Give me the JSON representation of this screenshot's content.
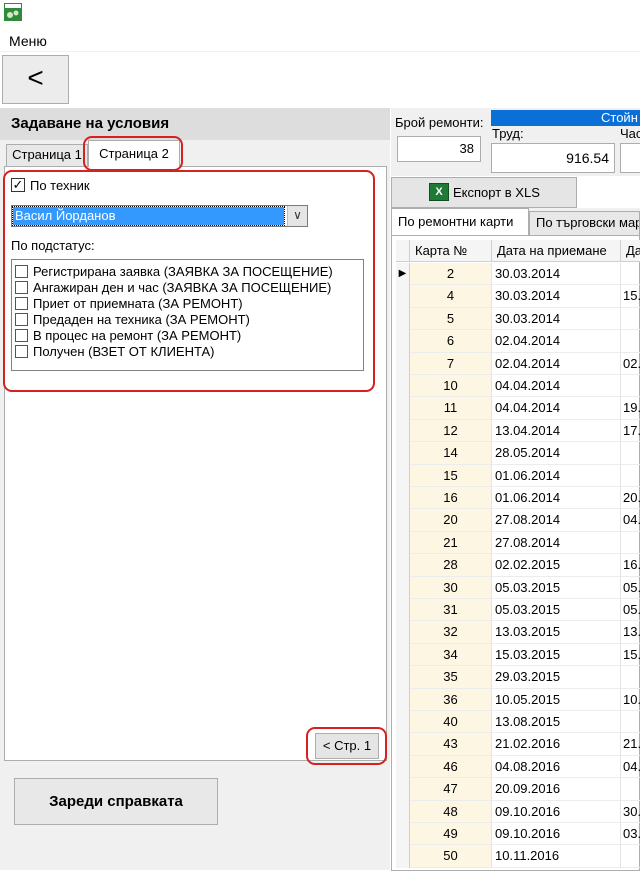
{
  "menu": {
    "label": "Меню"
  },
  "back_button": {
    "label": "<"
  },
  "left_panel": {
    "title": "Задаване на условия",
    "tabs": [
      "Страница 1",
      "Страница 2"
    ],
    "by_technician": {
      "label": "По техник",
      "checked": true
    },
    "technician_select": {
      "value": "Васил Йорданов"
    },
    "substatus_label": "По подстатус:",
    "substatus_items": [
      "Регистрирана заявка (ЗАЯВКА ЗА ПОСЕЩЕНИЕ)",
      "Ангажиран ден и час (ЗАЯВКА ЗА ПОСЕЩЕНИЕ)",
      "Приет от приемната (ЗА РЕМОНТ)",
      "Предаден на техника (ЗА РЕМОНТ)",
      "В процес на ремонт (ЗА РЕМОНТ)",
      "Получен (ВЗЕТ ОТ КЛИЕНТА)"
    ],
    "page1_button": "< Стр. 1",
    "load_button": "Зареди справката"
  },
  "summary": {
    "count_label": "Брой ремонти:",
    "count_value": "38",
    "value_header": "Стойн",
    "labor_label": "Труд:",
    "labor_value": "916.54",
    "hours_label": "Час"
  },
  "export_button": "Експорт в XLS",
  "export_icon": "excel-icon",
  "right_tabs": [
    "По ремонтни карти",
    "По търговски мар"
  ],
  "grid": {
    "headers": [
      "Карта №",
      "Дата на приемане",
      "Дат"
    ],
    "rows": [
      [
        "2",
        "30.03.2014",
        ""
      ],
      [
        "4",
        "30.03.2014",
        "15."
      ],
      [
        "5",
        "30.03.2014",
        ""
      ],
      [
        "6",
        "02.04.2014",
        ""
      ],
      [
        "7",
        "02.04.2014",
        "02."
      ],
      [
        "10",
        "04.04.2014",
        ""
      ],
      [
        "11",
        "04.04.2014",
        "19."
      ],
      [
        "12",
        "13.04.2014",
        "17."
      ],
      [
        "14",
        "28.05.2014",
        ""
      ],
      [
        "15",
        "01.06.2014",
        ""
      ],
      [
        "16",
        "01.06.2014",
        "20."
      ],
      [
        "20",
        "27.08.2014",
        "04."
      ],
      [
        "21",
        "27.08.2014",
        ""
      ],
      [
        "28",
        "02.02.2015",
        "16."
      ],
      [
        "30",
        "05.03.2015",
        "05."
      ],
      [
        "31",
        "05.03.2015",
        "05."
      ],
      [
        "32",
        "13.03.2015",
        "13."
      ],
      [
        "34",
        "15.03.2015",
        "15."
      ],
      [
        "35",
        "29.03.2015",
        ""
      ],
      [
        "36",
        "10.05.2015",
        "10."
      ],
      [
        "40",
        "13.08.2015",
        ""
      ],
      [
        "43",
        "21.02.2016",
        "21."
      ],
      [
        "46",
        "04.08.2016",
        "04."
      ],
      [
        "47",
        "20.09.2016",
        ""
      ],
      [
        "48",
        "09.10.2016",
        "30."
      ],
      [
        "49",
        "09.10.2016",
        "03."
      ],
      [
        "50",
        "10.11.2016",
        ""
      ]
    ]
  }
}
